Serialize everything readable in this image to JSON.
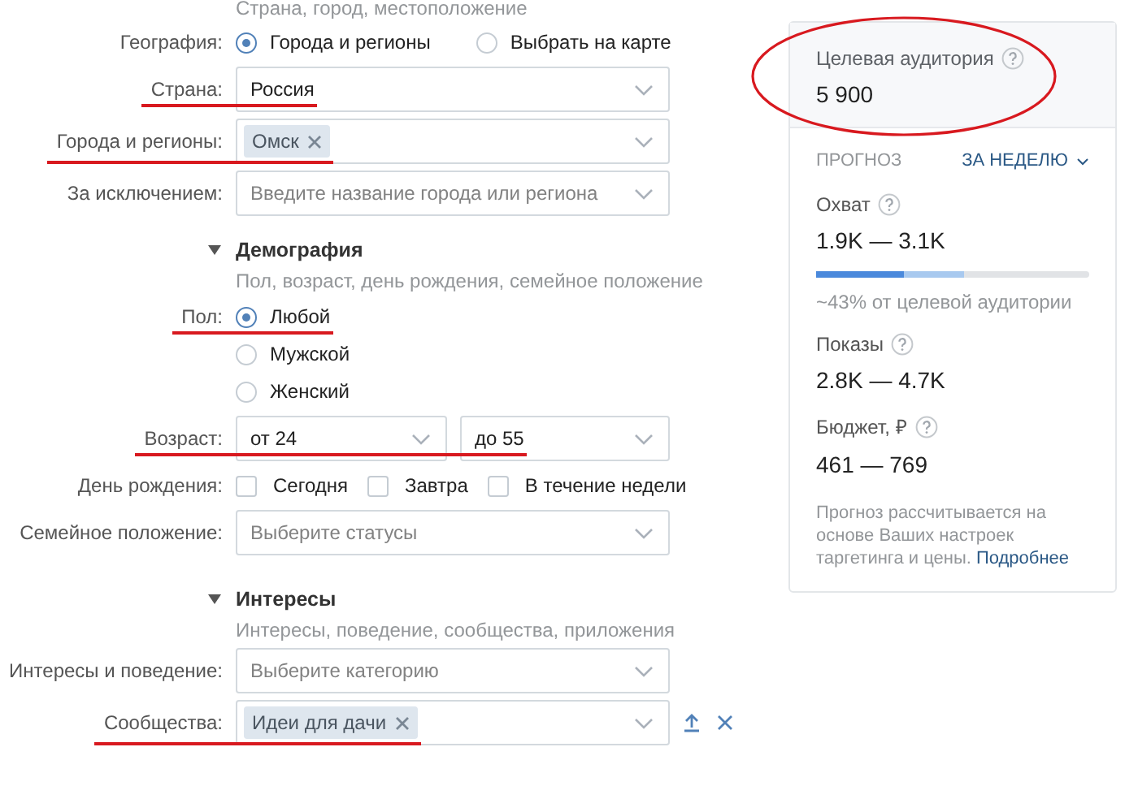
{
  "section_hint": "Страна, город, местоположение",
  "geography": {
    "label": "География:",
    "options": [
      {
        "label": "Города и регионы",
        "selected": true
      },
      {
        "label": "Выбрать на карте",
        "selected": false
      }
    ]
  },
  "location_fields": [
    {
      "label": "Страна:",
      "value": "Россия",
      "underlined": true
    },
    {
      "label": "Города и регионы:",
      "chips": [
        "Омск"
      ],
      "underlined": true
    },
    {
      "label": "За исключением:",
      "placeholder": "Введите название города или региона",
      "underlined": false
    }
  ],
  "demography": {
    "title": "Демография",
    "expanded": true,
    "subtitle": "Пол, возраст, день рождения, семейное положение",
    "gender": {
      "label": "Пол:",
      "underlined": true,
      "options": [
        {
          "label": "Любой",
          "selected": true
        },
        {
          "label": "Мужской",
          "selected": false
        },
        {
          "label": "Женский",
          "selected": false
        }
      ]
    },
    "age": {
      "label": "Возраст:",
      "underlined": true,
      "from": "от 24",
      "to": "до 55"
    },
    "birthday": {
      "label": "День рождения:",
      "options": [
        {
          "label": "Сегодня",
          "checked": false
        },
        {
          "label": "Завтра",
          "checked": false
        },
        {
          "label": "В течение недели",
          "checked": false
        }
      ]
    },
    "marital": {
      "label": "Семейное положение:",
      "placeholder": "Выберите статусы",
      "underlined": false
    }
  },
  "interests": {
    "title": "Интересы",
    "expanded": true,
    "subtitle": "Интересы, поведение, сообщества, приложения",
    "fields": [
      {
        "label": "Интересы и поведение:",
        "placeholder": "Выберите категорию",
        "underlined": false,
        "actions": false
      },
      {
        "label": "Сообщества:",
        "chips": [
          "Идеи для дачи"
        ],
        "underlined": true,
        "actions": true
      }
    ]
  },
  "panel": {
    "audience": {
      "label": "Целевая аудитория",
      "value": "5 900",
      "circled": true
    },
    "forecast": {
      "title": "ПРОГНОЗ",
      "period": "ЗА НЕДЕЛЮ"
    },
    "metrics": [
      {
        "label": "Охват",
        "value": "1.9K — 3.1K",
        "bar": [
          {
            "level": 0.32
          },
          {
            "level": 0.54
          }
        ],
        "note": "~43% от целевой аудитории"
      },
      {
        "label": "Показы",
        "value": "2.8K — 4.7K"
      },
      {
        "label": "Бюджет, ₽",
        "value": "461 — 769"
      }
    ],
    "footer": "Прогноз рассчитывается на основе Ваших настроек таргетинга и цены.",
    "footer_link": "Подробнее"
  }
}
